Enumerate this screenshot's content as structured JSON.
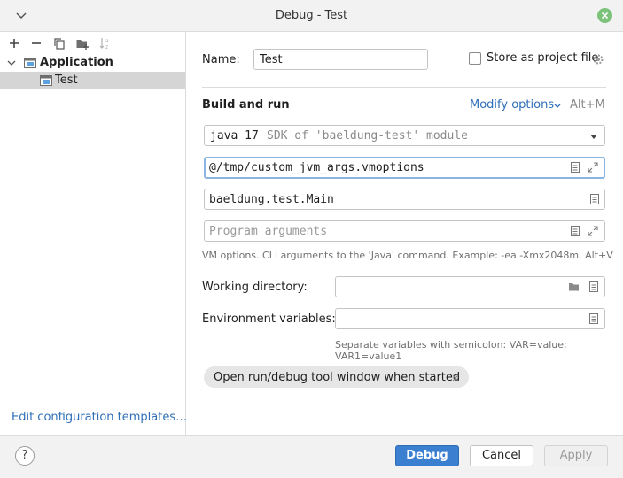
{
  "window": {
    "title": "Debug - Test"
  },
  "toolbar": {
    "icons": [
      "plus-icon",
      "minus-icon",
      "copy-icon",
      "folder-plus-icon",
      "sort-icon"
    ]
  },
  "tree": {
    "application_label": "Application",
    "test_label": "Test"
  },
  "left_footer": {
    "edit_templates_label": "Edit configuration templates…"
  },
  "form": {
    "name_label": "Name:",
    "name_value": "Test",
    "store_label": "Store as project file",
    "section_title": "Build and run",
    "modify_options_label": "Modify options",
    "modify_options_shortcut": "Alt+M",
    "sdk_java": "java 17",
    "sdk_hint": "SDK of 'baeldung-test' module",
    "vm_options_value": "@/tmp/custom_jvm_args.vmoptions",
    "main_class_value": "baeldung.test.Main",
    "program_args_placeholder": "Program arguments",
    "vm_options_hint": "VM options. CLI arguments to the 'Java' command. Example: -ea -Xmx2048m. Alt+V",
    "working_dir_label": "Working directory:",
    "working_dir_value": "",
    "env_vars_label": "Environment variables:",
    "env_vars_value": "",
    "env_hint": "Separate variables with semicolon: VAR=value; VAR1=value1",
    "chip_label": "Open run/debug tool window when started"
  },
  "buttons": {
    "debug": "Debug",
    "cancel": "Cancel",
    "apply": "Apply",
    "help": "?"
  },
  "colors": {
    "accent": "#3b7fd1",
    "link": "#2f6fb8",
    "close_green": "#7bc27b",
    "selected_row": "#d5d5d5"
  }
}
